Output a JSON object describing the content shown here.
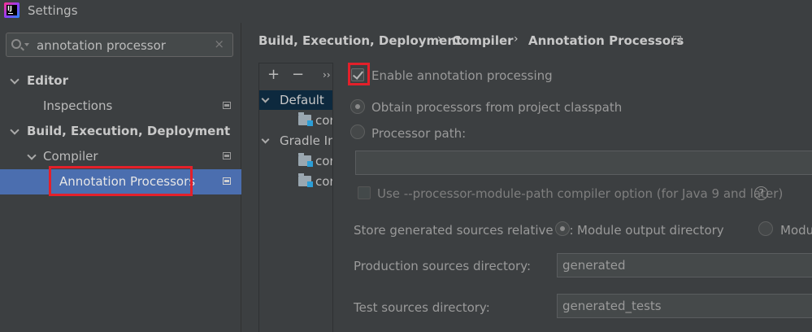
{
  "window": {
    "title": "Settings",
    "app_icon_text": "IJ"
  },
  "search": {
    "value": "annotation processor",
    "clear": "×"
  },
  "tree": {
    "editor": "Editor",
    "inspections": "Inspections",
    "build": "Build, Execution, Deployment",
    "compiler": "Compiler",
    "annotation_processors": "Annotation Processors"
  },
  "breadcrumb": {
    "part1": "Build, Execution, Deployment",
    "part2": "Compiler",
    "part3": "Annotation Processors",
    "sep": "›"
  },
  "profiles": {
    "add": "+",
    "remove": "−",
    "more": "››",
    "default": "Default",
    "gradle": "Gradle Imported",
    "module1": "core",
    "module2": "core",
    "module3": "core"
  },
  "form": {
    "enable_label": "Enable annotation processing",
    "enable_checked": true,
    "obtain_label": "Obtain processors from project classpath",
    "processor_path_label": "Processor path:",
    "processor_path_value": "",
    "module_path_label": "Use --processor-module-path compiler option (for Java 9 and later)",
    "help": "?",
    "store_label": "Store generated sources relative to:",
    "module_output_label": "Module output directory",
    "module_content_label": "Module content root",
    "production_label": "Production sources directory:",
    "production_value": "generated",
    "test_label": "Test sources directory:",
    "test_value": "generated_tests"
  },
  "colors": {
    "selection": "#4b6eaf",
    "highlight": "#e3202a",
    "background": "#3c3f41"
  }
}
